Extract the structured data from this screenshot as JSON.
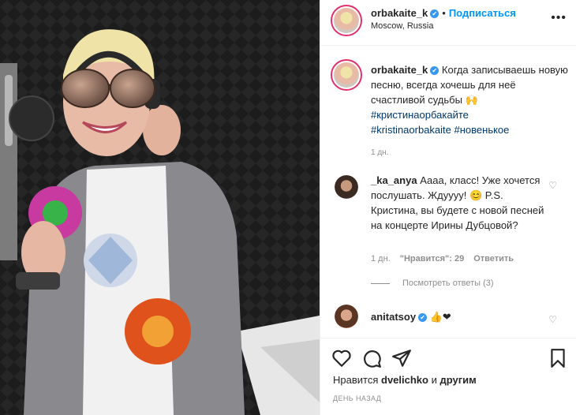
{
  "post": {
    "author": {
      "username": "orbakaite_k",
      "location": "Moscow, Russia",
      "follow_label": "Подписаться",
      "verified_glyph": "✔"
    },
    "more_glyph": "•••",
    "caption": {
      "username": "orbakaite_k",
      "text": "Когда записываешь новую песню, всегда хочешь для неё счастливой судьбы",
      "emoji": "🙌",
      "hashtag1": "#кристинаорбакайте",
      "hashtag2": "#kristinaorbakaite",
      "hashtag3": "#новенькое",
      "time": "1 дн."
    },
    "comments": [
      {
        "username": "_ka_anya",
        "text": "Аааа, класс! Уже хочется послушать. Ждуууу! 😊 P.S. Кристина, вы будете с новой песней на концерте Ирины Дубцовой?",
        "time": "1 дн.",
        "likes": "\"Нравится\": 29",
        "reply_label": "Ответить",
        "view_replies": "Посмотреть ответы (3)"
      },
      {
        "username": "anitatsoy",
        "text": "👍❤"
      }
    ],
    "likes_line": {
      "prefix": "Нравится",
      "user": "dvelichko",
      "joiner": "и",
      "others": "другим"
    },
    "date_label": "ДЕНЬ НАЗАД",
    "icons": [
      "heart-icon",
      "comment-icon",
      "share-icon",
      "bookmark-icon",
      "more-icon"
    ],
    "colors": {
      "accent": "#0095f6",
      "verified": "#3897f0",
      "muted": "#8e8e8e",
      "hashtag": "#00376b",
      "ring": "#e1306c"
    }
  }
}
